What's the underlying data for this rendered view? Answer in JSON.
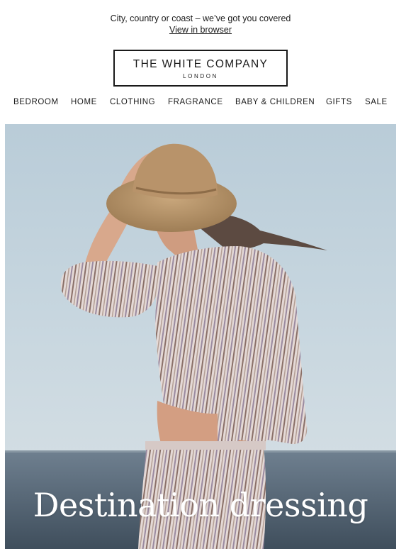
{
  "preheader": {
    "tagline": "City, country or coast – we’ve got you covered",
    "view_in_browser": "View in browser"
  },
  "logo": {
    "brand": "THE WHITE COMPANY",
    "location": "LONDON"
  },
  "nav": {
    "items": [
      "BEDROOM",
      "HOME",
      "CLOTHING",
      "FRAGRANCE",
      "BABY & CHILDREN",
      "GIFTS",
      "SALE"
    ]
  },
  "hero": {
    "headline": "Destination dressing",
    "image": "woman-in-striped-outfit-and-straw-hat-by-sea"
  },
  "colors": {
    "text": "#1a1a1a",
    "sky": "#c7d6df",
    "sea": "#4a5a68",
    "headline": "#ffffff"
  }
}
